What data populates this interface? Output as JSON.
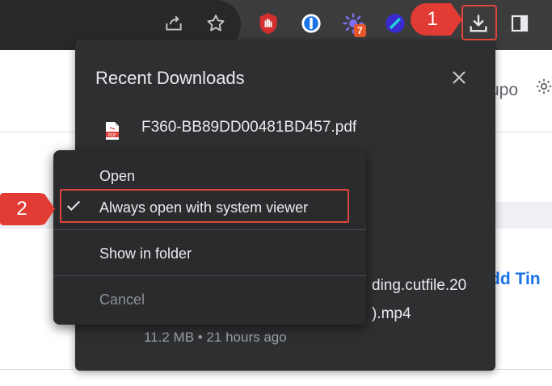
{
  "toolbar": {
    "icons": [
      "share-icon",
      "star-icon",
      "ublock-icon",
      "onepassword-icon",
      "extension-icon",
      "extension-icon-2",
      "downloads-icon",
      "side-panel-icon"
    ],
    "extension_badge": "7"
  },
  "page_background": {
    "text_fragment": "upo",
    "file_text_a": "ding.cutfile.20",
    "file_text_b": ").mp4",
    "link_fragment": "dd Tin"
  },
  "download_bubble": {
    "title": "Recent Downloads",
    "items": [
      {
        "name": "F360-BB89DD00481BD457.pdf",
        "icon": "pdf-icon"
      },
      {
        "meta": "11.2 MB • 21 hours ago"
      }
    ]
  },
  "context_menu": {
    "items": [
      {
        "label": "Open",
        "enabled": true
      },
      {
        "label": "Always open with system viewer",
        "checked": true,
        "enabled": true
      },
      {
        "label": "Show in folder",
        "enabled": true
      },
      {
        "label": "Cancel",
        "enabled": false
      }
    ]
  },
  "annotations": {
    "step1": "1",
    "step2": "2",
    "highlight_color": "#e0453b"
  },
  "colors": {
    "toolbar": "#3c3c3c",
    "bubble": "#2e2f31",
    "menu": "#2a2b2d",
    "text": "#e8eaed"
  }
}
